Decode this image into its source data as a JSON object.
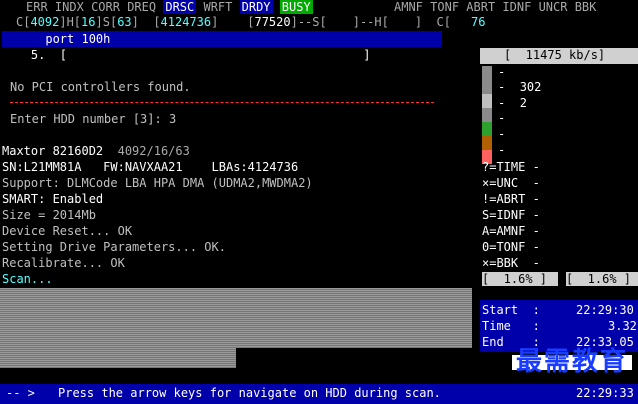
{
  "header": {
    "columns": [
      "ERR",
      "INDX",
      "CORR",
      "DREQ",
      "DRSC",
      "WRFT",
      "DRDY",
      "BUSY"
    ],
    "right_columns": [
      "AMNF",
      "TONF",
      "ABRT",
      "IDNF",
      "UNCR",
      "BBK"
    ],
    "c_label": "C[",
    "c_value": "4092",
    "h_label": "]H[",
    "h_value": "16",
    "s_label": "]S[",
    "s_value": "63",
    "bracket_open": "]  [",
    "lba_value": "4124736",
    "bracket_close": "]    [",
    "cyl_value": "77520",
    "s_mid": "]--S[",
    "h_mid": "]--H[",
    "c_mid": "]  C[",
    "c_end": "76"
  },
  "port_line": "      port 100h",
  "select_line": "    5.  [                                         ]",
  "no_pci": "No PCI controllers found.",
  "enter_hdd": "Enter HDD number [3]: 3",
  "drive": {
    "model": "Maxtor 82160D2",
    "geometry": "4092/16/63",
    "sn_line": "SN:L21MM81A   FW:NAVXAA21    LBAs:4124736",
    "support": "Support: DLMCode LBA HPA DMA (UDMA2,MWDMA2)",
    "smart": "SMART: Enabled",
    "size": "Size = 2014Mb",
    "reset": "Device Reset... OK",
    "params": "Setting Drive Parameters... OK.",
    "recal": "Recalibrate... OK",
    "scan": "Scan..."
  },
  "speed": "[  11475 kb/s]",
  "bars": [
    {
      "label": "-",
      "value": ""
    },
    {
      "label": "-",
      "value": "302"
    },
    {
      "label": "-",
      "value": "2"
    },
    {
      "label": "-",
      "value": ""
    },
    {
      "label": "-",
      "value": ""
    },
    {
      "label": "-",
      "value": ""
    }
  ],
  "bar_colors": [
    "#8a8a8a",
    "#8a8a8a",
    "#c0c0c0",
    "#8a8a8a",
    "#2ea02e",
    "#b06000",
    "#ff6060"
  ],
  "legend": [
    "?=TIME -",
    "×=UNC  -",
    "!=ABRT -",
    "S=IDNF -",
    "A=AMNF -",
    "0=TONF -",
    "×=BBK  -"
  ],
  "pct_left": "[  1.6% ]",
  "pct_right": "[  1.6% ]",
  "times": {
    "start_label": "Start  :",
    "start_value": "22:29:30",
    "time_label": "Time   :",
    "time_value": "3.32",
    "end_label": "End    :",
    "end_value": "22:33.05"
  },
  "status": {
    "arrow": "-- >",
    "message": "Press the arrow keys for navigate on HDD during scan.",
    "clock": "22:29:33"
  },
  "watermark": "最需教育"
}
